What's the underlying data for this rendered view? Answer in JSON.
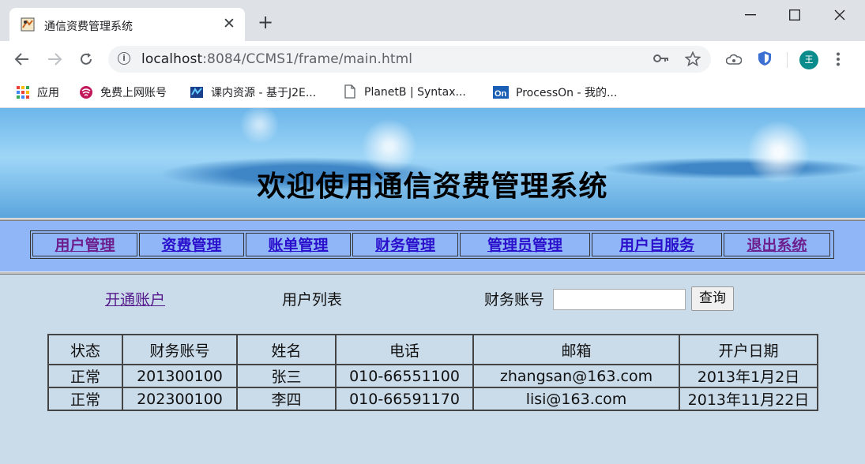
{
  "browser": {
    "tab_title": "通信资费管理系统",
    "close_symbol": "✕",
    "newtab_symbol": "+",
    "url_host": "localhost",
    "url_rest": ":8084/CCMS1/frame/main.html",
    "avatar_text": "王",
    "bookmarks": [
      {
        "label": "应用",
        "icon": "apps-grid-icon"
      },
      {
        "label": "免费上网账号",
        "icon": "free-wifi-icon"
      },
      {
        "label": "课内资源 - 基于J2E...",
        "icon": "j2ee-icon"
      },
      {
        "label": "PlanetB | Syntax...",
        "icon": "page-icon"
      },
      {
        "label": "ProcessOn - 我的...",
        "icon": "processon-icon"
      }
    ]
  },
  "page": {
    "banner_title": "欢迎使用通信资费管理系统",
    "nav": [
      {
        "label": "用户管理",
        "visited": true
      },
      {
        "label": "资费管理",
        "visited": false
      },
      {
        "label": "账单管理",
        "visited": false
      },
      {
        "label": "财务管理",
        "visited": false
      },
      {
        "label": "管理员管理",
        "visited": false
      },
      {
        "label": "用户自服务",
        "visited": false
      },
      {
        "label": "退出系统",
        "visited": true
      }
    ],
    "open_account_link": "开通账户",
    "list_title": "用户列表",
    "account_label": "财务账号",
    "account_input_value": "",
    "query_button": "查询",
    "table": {
      "headers": [
        "状态",
        "财务账号",
        "姓名",
        "电话",
        "邮箱",
        "开户日期"
      ],
      "rows": [
        [
          "正常",
          "201300100",
          "张三",
          "010-66551100",
          "zhangsan@163.com",
          "2013年1月2日"
        ],
        [
          "正常",
          "202300100",
          "李四",
          "010-66591170",
          "lisi@163.com",
          "2013年11月22日"
        ]
      ]
    }
  },
  "colors": {
    "nav_bg": "#91b6f8",
    "page_bg": "#cadbea",
    "link": "#2a0fcc",
    "visited_link": "#6d1f8e"
  }
}
